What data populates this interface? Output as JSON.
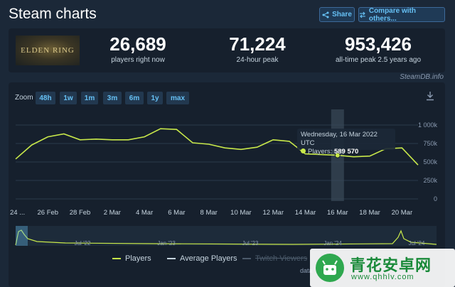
{
  "header": {
    "title": "Steam charts",
    "share_label": "Share",
    "compare_label": "Compare with others..."
  },
  "game": {
    "logo_text": "ELDEN RING"
  },
  "stats": [
    {
      "value": "26,689",
      "label": "players right now"
    },
    {
      "value": "71,224",
      "label": "24-hour peak"
    },
    {
      "value": "953,426",
      "label": "all-time peak 2.5 years ago"
    }
  ],
  "brand": "SteamDB.info",
  "zoom": {
    "label": "Zoom",
    "options": [
      "48h",
      "1w",
      "1m",
      "3m",
      "6m",
      "1y",
      "max"
    ]
  },
  "tooltip": {
    "date": "Wednesday, 16 Mar 2022 UTC",
    "series_label": "Players:",
    "value": "589 570"
  },
  "chart_data": {
    "type": "line",
    "series": [
      {
        "name": "Players",
        "color": "#c8e84a",
        "x": [
          "24 Feb",
          "25 Feb",
          "26 Feb",
          "27 Feb",
          "28 Feb",
          "1 Mar",
          "2 Mar",
          "3 Mar",
          "4 Mar",
          "5 Mar",
          "6 Mar",
          "7 Mar",
          "8 Mar",
          "9 Mar",
          "10 Mar",
          "11 Mar",
          "12 Mar",
          "13 Mar",
          "14 Mar",
          "15 Mar",
          "16 Mar",
          "17 Mar",
          "18 Mar",
          "19 Mar",
          "20 Mar",
          "21 Mar"
        ],
        "values": [
          540,
          730,
          840,
          880,
          800,
          810,
          800,
          800,
          840,
          950,
          940,
          760,
          740,
          690,
          670,
          700,
          800,
          780,
          610,
          600,
          590,
          570,
          580,
          680,
          690,
          460
        ]
      }
    ],
    "yticks": [
      "0",
      "250k",
      "500k",
      "750k",
      "1 000k"
    ],
    "ylim": [
      0,
      1000
    ],
    "xticks": [
      "24 ...",
      "26 Feb",
      "28 Feb",
      "2 Mar",
      "4 Mar",
      "6 Mar",
      "8 Mar",
      "10 Mar",
      "12 Mar",
      "14 Mar",
      "16 Mar",
      "18 Mar",
      "20 Mar"
    ],
    "highlight_index": 20,
    "navigator_ticks": [
      "Jul '22",
      "Jan '23",
      "Jul '23",
      "Jan '24",
      "Jul '24"
    ]
  },
  "legend": [
    {
      "label": "Players",
      "color": "#c8e84a"
    },
    {
      "label": "Average Players",
      "color": "#c6d4df"
    },
    {
      "label": "Twitch Viewers",
      "color": "#4b5a6a"
    }
  ],
  "credits": "data",
  "watermark": {
    "text": "青花安卓网",
    "url": "www.qhhlv.com"
  }
}
